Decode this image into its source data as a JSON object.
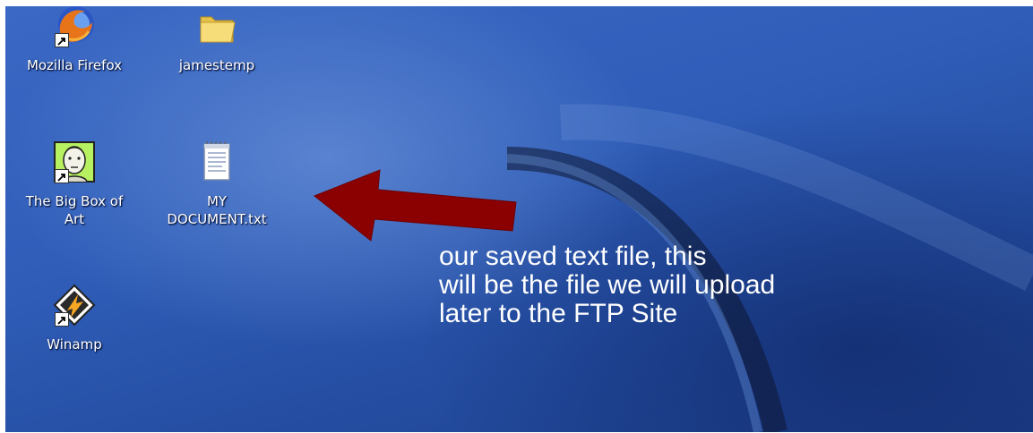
{
  "desktop": {
    "icons": [
      {
        "label": "Mozilla Firefox",
        "icon": "firefox-icon"
      },
      {
        "label": "jamestemp",
        "icon": "folder-icon"
      },
      {
        "label": "The Big Box of Art",
        "icon": "big-box-of-art-icon"
      },
      {
        "label": "MY DOCUMENT.txt",
        "icon": "text-file-icon"
      },
      {
        "label": "Winamp",
        "icon": "winamp-icon"
      }
    ],
    "annotation": {
      "lines": [
        "our saved text file, this",
        "will be the file we will upload",
        "later to the FTP Site"
      ],
      "arrow_color": "#8b0000"
    }
  }
}
